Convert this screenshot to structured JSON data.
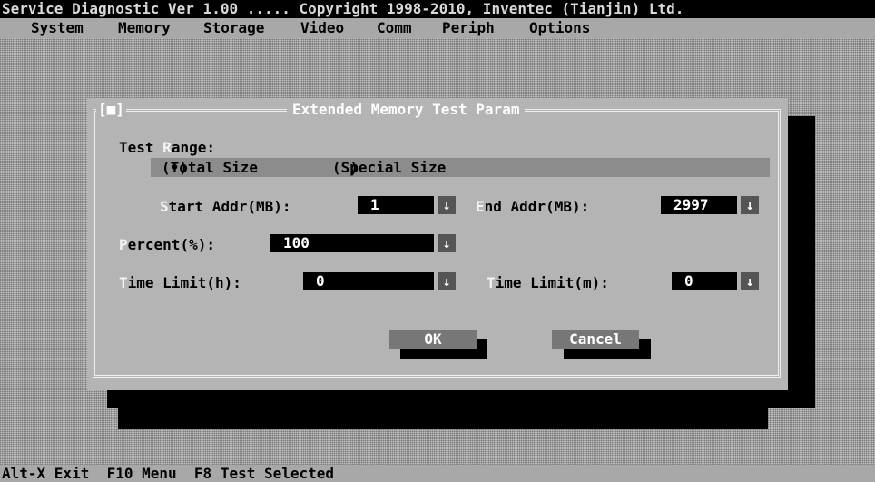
{
  "window": {
    "title": "Service Diagnostic Ver 1.00 ..... Copyright 1998-2010, Inventec (Tianjin) Ltd."
  },
  "menu": {
    "items": [
      "System",
      "Memory",
      "Storage",
      "Video",
      "Comm",
      "Periph",
      "Options"
    ]
  },
  "dialog": {
    "close_box": "[■]",
    "title": "Extended Memory Test Param",
    "test_range": {
      "label_prefix": "Test ",
      "label_hot": "R",
      "label_rest": "ange:",
      "options": [
        {
          "mark": "(•)",
          "label": "Total Size"
        },
        {
          "mark": "( )",
          "label": "Special Size"
        }
      ]
    },
    "start_addr": {
      "hot": "S",
      "rest": "tart Addr(MB):",
      "value": "1"
    },
    "end_addr": {
      "hot": "E",
      "rest": "nd Addr(MB):",
      "value": "2997"
    },
    "percent": {
      "hot": "P",
      "rest": "ercent(%):",
      "value": "100"
    },
    "time_limit_h": {
      "hot": "T",
      "rest": "ime Limit(h):",
      "value": "0"
    },
    "time_limit_m": {
      "hot": "T",
      "rest": "ime Limit(m):",
      "value": "0"
    },
    "arrow_glyph": "↓",
    "ok_label": "OK",
    "cancel_label": "Cancel"
  },
  "statusbar": {
    "text": "Alt-X Exit  F10 Menu  F8 Test Selected"
  },
  "colors": {
    "titlebar_bg": "#000000",
    "dialog_bg": "#b4b4b4",
    "field_bg": "#000000",
    "field_text": "#ffffff",
    "hotkey": "#f4f4f4"
  }
}
